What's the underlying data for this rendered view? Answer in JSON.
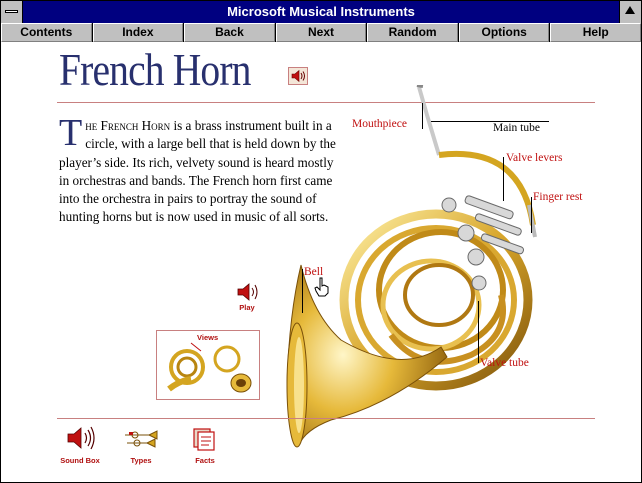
{
  "window": {
    "title": "Microsoft Musical Instruments"
  },
  "nav": [
    "Contents",
    "Index",
    "Back",
    "Next",
    "Random",
    "Options",
    "Help"
  ],
  "article": {
    "title": "French Horn",
    "dropcap": "T",
    "lead_smallcaps": "he French Horn",
    "body": " is a brass instrument built in a circle, with a large bell that is held down by the player’s side. Its rich, velvety sound is heard mostly in orchestras and bands. The French horn first came into the orchestra in pairs to portray the sound of hunting horns but is now used in music of all sorts."
  },
  "callouts": {
    "mouthpiece": "Mouthpiece",
    "main_tube": "Main tube",
    "valve_levers": "Valve levers",
    "finger_rest": "Finger rest",
    "bell": "Bell",
    "valve_tube": "Valve tube"
  },
  "controls": {
    "play": "Play",
    "views": "Views",
    "sound_box": "Sound Box",
    "types": "Types",
    "facts": "Facts"
  },
  "colors": {
    "title_bar": "#000080",
    "heading": "#28306e",
    "accent_red": "#c01010",
    "brass": "#d4a520"
  },
  "icons": [
    "speaker-icon",
    "hand-cursor-icon",
    "sound-box-icon",
    "types-icon",
    "facts-icon"
  ]
}
